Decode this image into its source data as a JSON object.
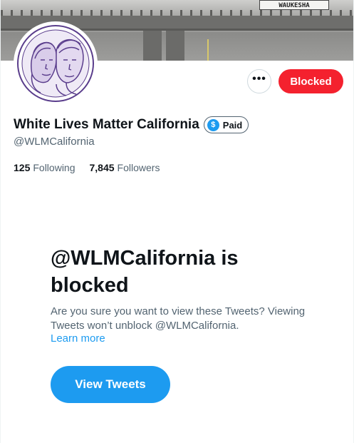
{
  "banner": {
    "sign_text": "WAUKESHA"
  },
  "actions": {
    "more_label": "•••",
    "blocked_label": "Blocked"
  },
  "profile": {
    "display_name": "White Lives Matter California",
    "badge_label": "Paid",
    "badge_symbol": "$",
    "handle": "@WLMCalifornia",
    "following_count": "125",
    "following_label": "Following",
    "followers_count": "7,845",
    "followers_label": "Followers"
  },
  "blocked_panel": {
    "title": "@WLMCalifornia is blocked",
    "message": "Are you sure you want to view these Tweets? Viewing Tweets won’t unblock @WLMCalifornia.",
    "learn_more": "Learn more",
    "view_button": "View Tweets"
  },
  "colors": {
    "blocked_red": "#f4212e",
    "accent_blue": "#1d9bf0",
    "secondary_text": "#536471",
    "avatar_ink": "#5a3d8c"
  }
}
